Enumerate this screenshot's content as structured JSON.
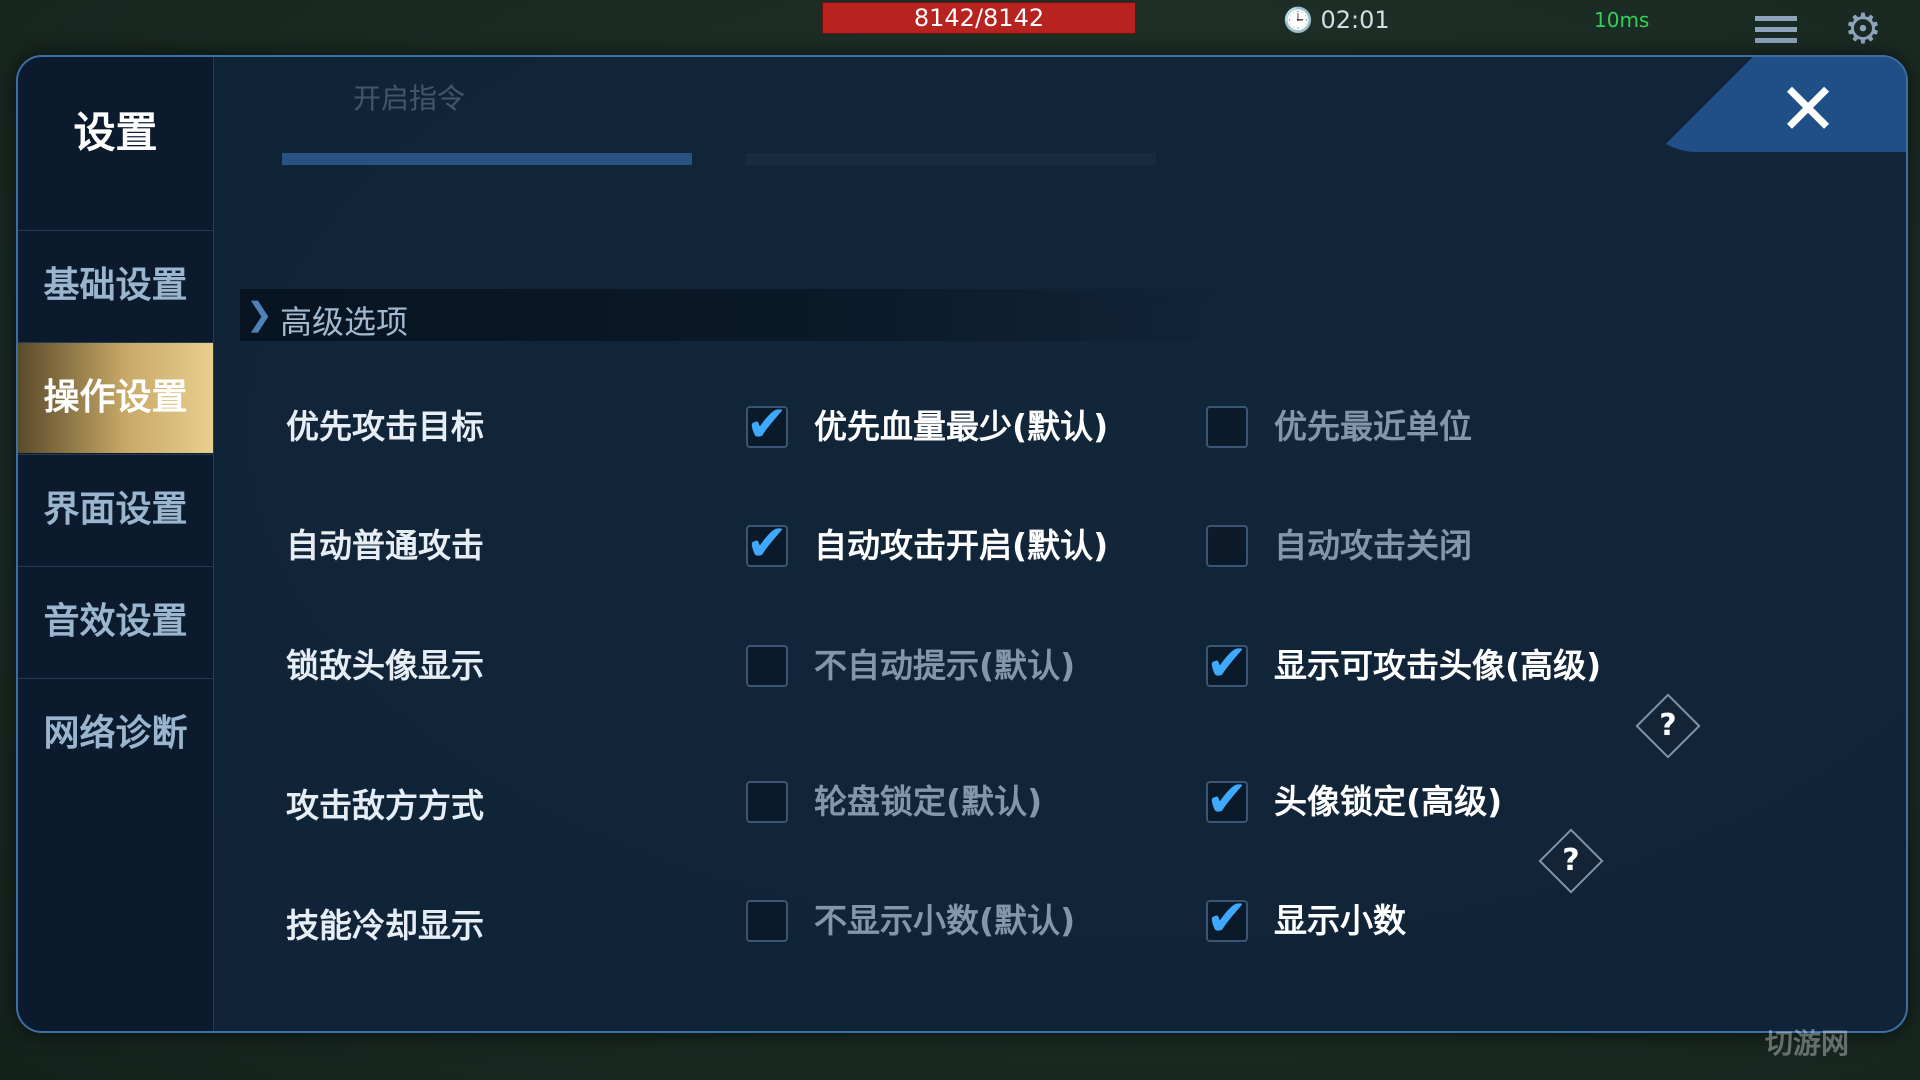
{
  "hud": {
    "hp": "8142/8142",
    "timer": "02:01",
    "ping": "10ms"
  },
  "watermark": "切游网",
  "settings": {
    "title": "设置",
    "nav": [
      {
        "label": "基础设置",
        "active": false
      },
      {
        "label": "操作设置",
        "active": true
      },
      {
        "label": "界面设置",
        "active": false
      },
      {
        "label": "音效设置",
        "active": false
      },
      {
        "label": "网络诊断",
        "active": false
      }
    ],
    "background_label": "开启指令",
    "section_title": "高级选项",
    "rows": [
      {
        "label": "优先攻击目标",
        "option1": {
          "label": "优先血量最少(默认)",
          "checked": true
        },
        "option2": {
          "label": "优先最近单位",
          "checked": false,
          "help": false
        }
      },
      {
        "label": "自动普通攻击",
        "option1": {
          "label": "自动攻击开启(默认)",
          "checked": true
        },
        "option2": {
          "label": "自动攻击关闭",
          "checked": false,
          "help": false
        }
      },
      {
        "label": "锁敌头像显示",
        "option1": {
          "label": "不自动提示(默认)",
          "checked": false
        },
        "option2": {
          "label": "显示可攻击头像(高级)",
          "checked": true,
          "help": true
        }
      },
      {
        "label": "攻击敌方方式",
        "option1": {
          "label": "轮盘锁定(默认)",
          "checked": false
        },
        "option2": {
          "label": "头像锁定(高级)",
          "checked": true,
          "help": true
        }
      },
      {
        "label": "技能冷却显示",
        "option1": {
          "label": "不显示小数(默认)",
          "checked": false
        },
        "option2": {
          "label": "显示小数",
          "checked": true,
          "help": false
        }
      }
    ],
    "tick_glyph": "✔",
    "help_glyph": "?",
    "close_glyph": "✕"
  }
}
